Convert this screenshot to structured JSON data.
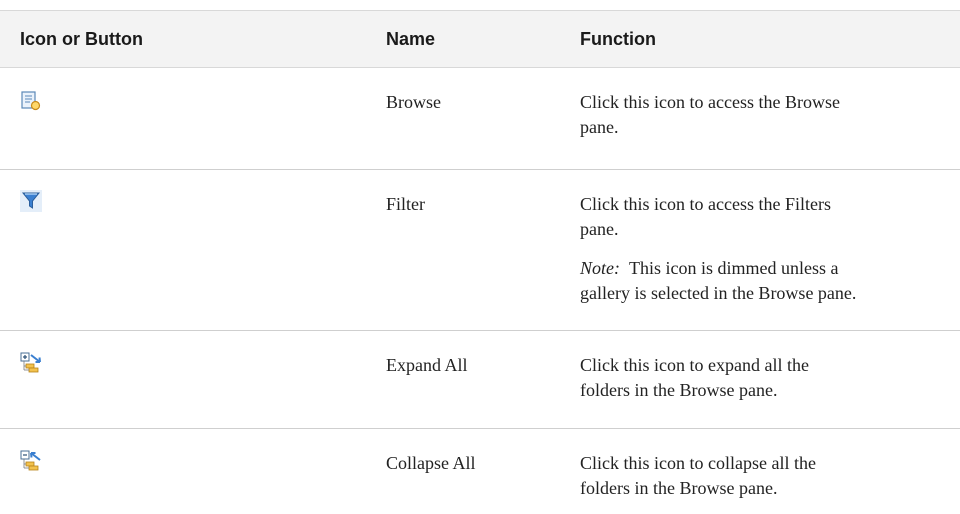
{
  "header": {
    "col_icon": "Icon or Button",
    "col_name": "Name",
    "col_function": "Function"
  },
  "rows": [
    {
      "icon": "browse-pane-icon",
      "name": "Browse",
      "function_line1": "Click this icon to access the Browse",
      "function_line2": "pane."
    },
    {
      "icon": "filter-funnel-icon",
      "name": "Filter",
      "function_line1": "Click this icon to access the Filters",
      "function_line2": "pane.",
      "note_label": "Note:",
      "note_line1": "This icon is dimmed unless a",
      "note_line2": "gallery is selected in the Browse pane."
    },
    {
      "icon": "expand-all-icon",
      "name": "Expand All",
      "function_line1": "Click this icon to expand all the",
      "function_line2": "folders in the Browse pane."
    },
    {
      "icon": "collapse-all-icon",
      "name": "Collapse All",
      "function_line1": "Click this icon to collapse all the",
      "function_line2": "folders in the Browse pane."
    }
  ],
  "colors": {
    "header_bg": "#f3f3f3",
    "divider": "#cfcfcf",
    "icon_blue": "#3a7fd0",
    "icon_orange": "#e8a23a"
  }
}
